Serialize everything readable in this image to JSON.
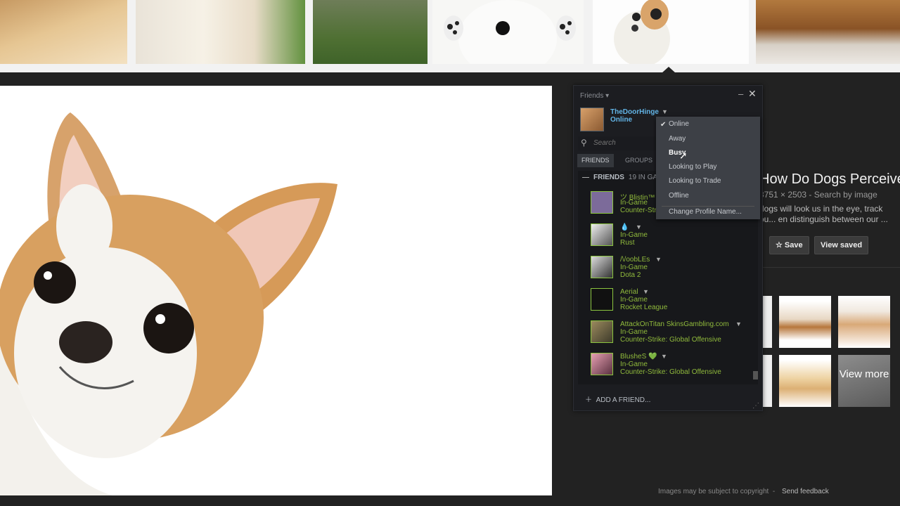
{
  "friends_window": {
    "title": "Friends",
    "user": {
      "name": "TheDoorHinge",
      "status": "Online"
    },
    "search_placeholder": "Search",
    "tabs": [
      {
        "label": "FRIENDS"
      },
      {
        "label": "GROUPS"
      }
    ],
    "section": {
      "label": "FRIENDS",
      "count": "19 IN GA"
    },
    "friends": [
      {
        "name": "ツ Blistin™",
        "status": "In-Game",
        "game": "Counter-Stri"
      },
      {
        "name": "💧",
        "status": "In-Game",
        "game": "Rust"
      },
      {
        "name": "/\\/oobLEs",
        "status": "In-Game",
        "game": "Dota 2"
      },
      {
        "name": "Aerial",
        "status": "In-Game",
        "game": "Rocket League"
      },
      {
        "name": "AttackOnTitan SkinsGambling.com",
        "status": "In-Game",
        "game": "Counter-Strike: Global Offensive"
      },
      {
        "name": "BlusheS 💚",
        "status": "In-Game",
        "game": "Counter-Strike: Global Offensive"
      }
    ],
    "add_friend": "ADD A FRIEND...",
    "status_menu": {
      "items": [
        "Online",
        "Away",
        "Busy",
        "Looking to Play",
        "Looking to Trade",
        "Offline"
      ],
      "selected": "Online",
      "hovered": "Busy",
      "change_name": "Change Profile Name..."
    }
  },
  "image_info": {
    "title": "How Do Dogs Perceive",
    "meta": "3751 × 2503 - Search by image",
    "description": "dogs will look us in the eye, track ou... en distinguish between our ...",
    "save_label": "Save",
    "view_saved_label": "View saved",
    "view_more_label": "View more"
  },
  "footer": {
    "copyright": "Images may be subject to copyright",
    "dash": "-",
    "feedback": "Send feedback"
  },
  "colors": {
    "steam_online_blue": "#62b4e6",
    "steam_ingame_green": "#90ba3c",
    "steam_bg": "#1c1d21"
  }
}
